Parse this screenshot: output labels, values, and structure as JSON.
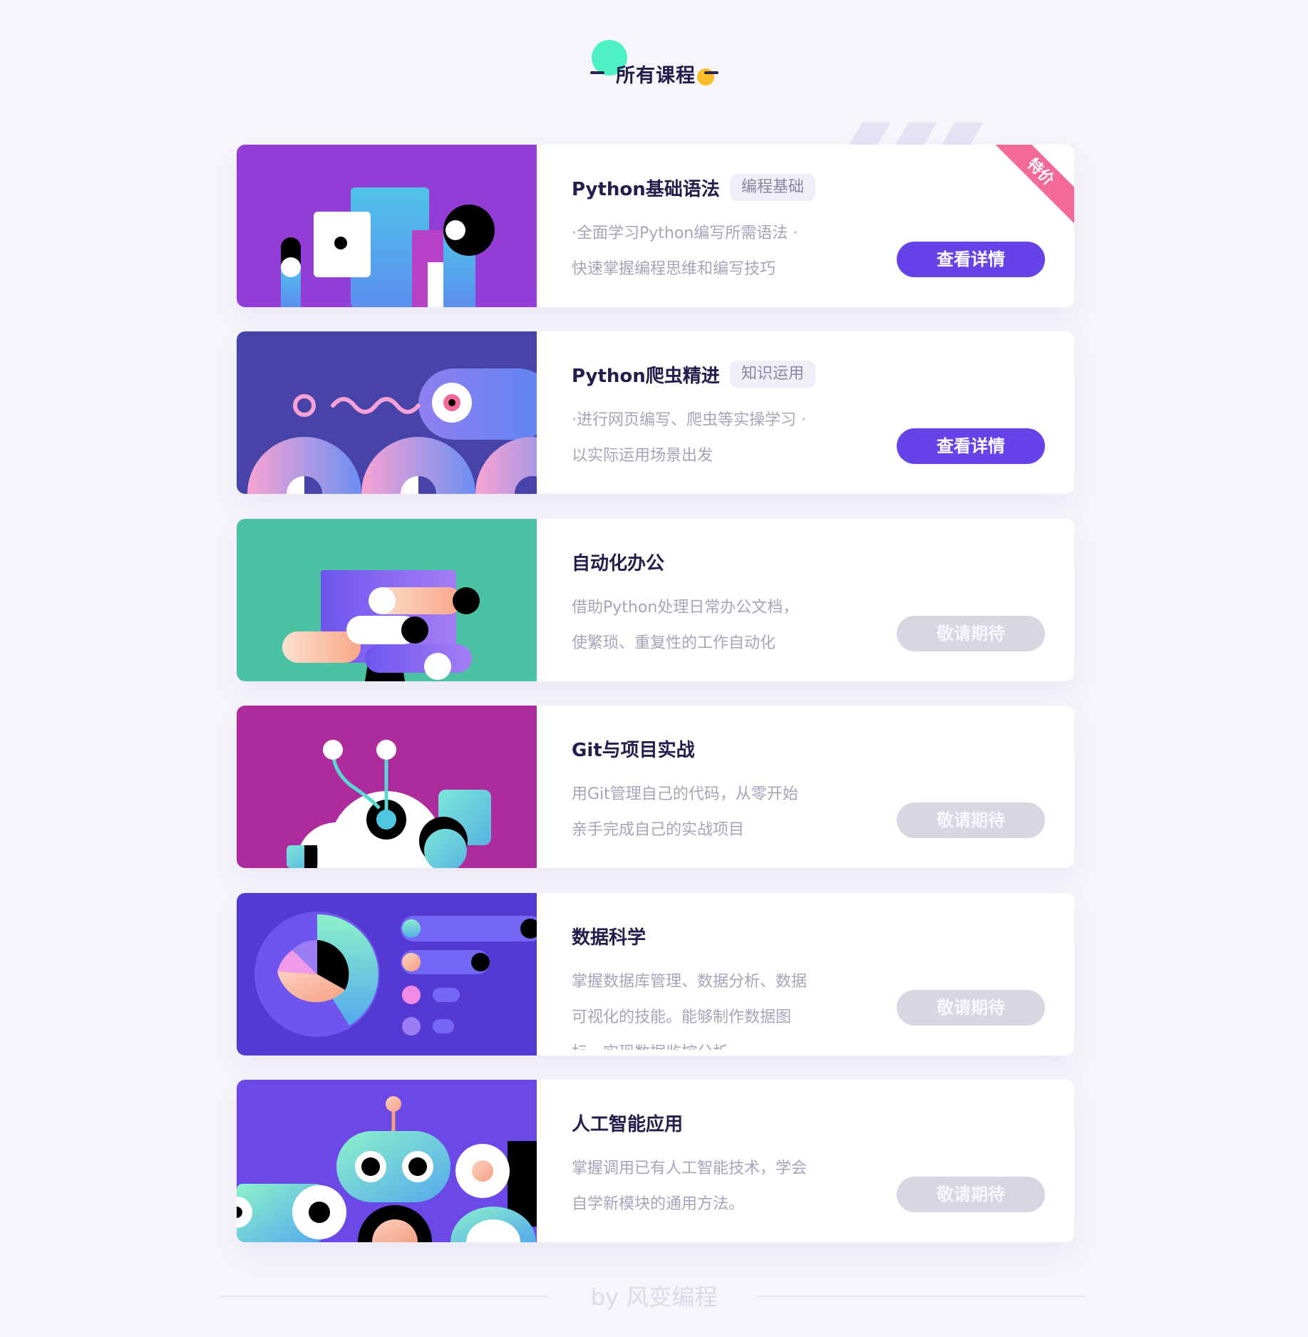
{
  "page": {
    "title": "所有课程"
  },
  "courses": [
    {
      "title": "Python基础语法",
      "tag": "编程基础",
      "description": "·全面学习Python编写所需语法 ·快速掌握编程思维和编写技巧",
      "button": "查看详情",
      "badge": "特价",
      "illustration": "python-basics-illustration",
      "bg_color": "#933dd7"
    },
    {
      "title": "Python爬虫精进",
      "tag": "知识运用",
      "description": "·进行网页编写、爬虫等实操学习 ·以实际运用场景出发",
      "button": "查看详情",
      "illustration": "spider-illustration",
      "bg_color": "#4843a9"
    },
    {
      "title": "自动化办公",
      "description": "借助Python处理日常办公文档，使繁琐、重复性的工作自动化",
      "button": "敬请期待",
      "illustration": "automation-illustration",
      "bg_color": "#4cc2a4"
    },
    {
      "title": "Git与项目实战",
      "description": "用Git管理自己的代码，从零开始亲手完成自己的实战项目",
      "button": "敬请期待",
      "illustration": "git-illustration",
      "bg_color": "#ad2b9c"
    },
    {
      "title": "数据科学",
      "description": "掌握数据库管理、数据分析、数据可视化的技能。能够制作数据图标，实现数据监控分析",
      "button": "敬请期待",
      "illustration": "data-science-illustration",
      "bg_color": "#5439d2"
    },
    {
      "title": "人工智能应用",
      "description": "掌握调用已有人工智能技术，学会自学新模块的通用方法。",
      "button": "敬请期待",
      "illustration": "ai-illustration",
      "bg_color": "#6c48e6"
    }
  ],
  "footer": {
    "text": "by 风变编程"
  },
  "colors": {
    "accent": "#6543e8",
    "disabled": "#d8d6e3",
    "badge": "#f46a96",
    "title": "#241c4b"
  }
}
